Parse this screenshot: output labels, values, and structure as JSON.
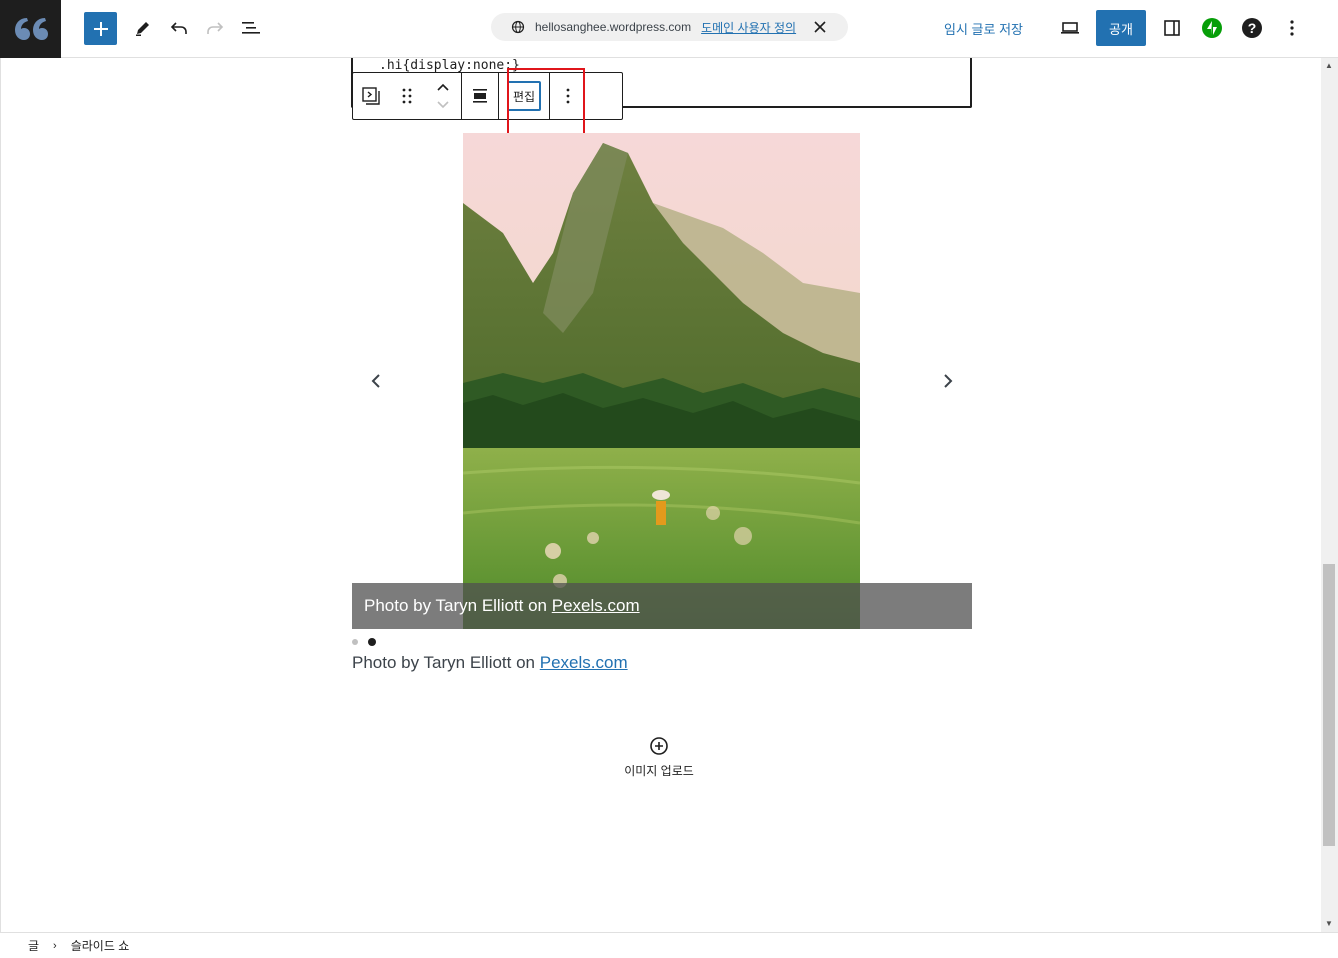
{
  "topbar": {
    "url": "hellosanghee.wordpress.com",
    "domain_link": "도메인 사용자 정의",
    "save_draft": "임시 글로 저장",
    "publish": "공개"
  },
  "editor": {
    "code_line": ".hi{display:none;}",
    "toolbar_edit_label": "편집",
    "slide_caption_prefix": "Photo by Taryn Elliott on ",
    "slide_caption_link": "Pexels.com",
    "caption_prefix": "Photo by Taryn Elliott on ",
    "caption_link": "Pexels.com",
    "upload_label": "이미지 업로드"
  },
  "breadcrumb": {
    "items": [
      "글",
      "슬라이드 쇼"
    ]
  },
  "colors": {
    "accent": "#2271b1",
    "highlight": "#e0151b",
    "logo_bg": "#1e1e1e",
    "jetpack": "#069e08"
  }
}
